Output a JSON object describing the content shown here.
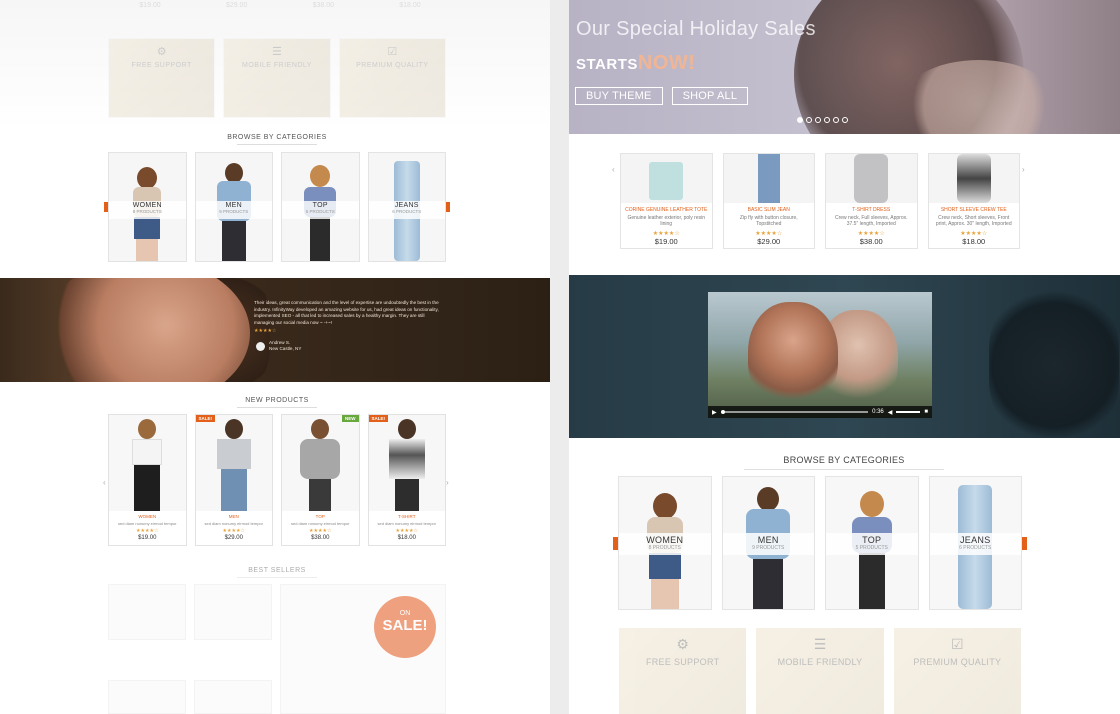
{
  "left": {
    "top_prices": [
      "$19.00",
      "$29.00",
      "$38.00",
      "$18.00"
    ],
    "features": [
      {
        "icon": "gears-icon",
        "title": "FREE SUPPORT"
      },
      {
        "icon": "mobile-icon",
        "title": "MOBILE FRIENDLY"
      },
      {
        "icon": "check-badge-icon",
        "title": "PREMIUM QUALITY"
      }
    ],
    "browse_title": "BROWSE BY CATEGORIES",
    "categories": [
      {
        "name": "WOMEN",
        "count": "8 PRODUCTS"
      },
      {
        "name": "MEN",
        "count": "9 PRODUCTS"
      },
      {
        "name": "TOP",
        "count": "5 PRODUCTS"
      },
      {
        "name": "JEANS",
        "count": "6 PRODUCTS"
      }
    ],
    "testimonial": {
      "quote": "Their ideas, great communication and the level of expertise are undoubtedly the best in the industry. InfinityWay developed an amazing website for us, had great ideas on functionality, implemented SEO - all that led to increased sales by a healthy margin. They are still managing our social media now ~ -+~!",
      "stars": "★★★★☆",
      "author": "Andrew S.",
      "location": "New Castle, NY"
    },
    "new_products_title": "NEW PRODUCTS",
    "new_products": [
      {
        "name": "WOMEN",
        "desc": "sed diam nonumy eirmod tempor",
        "stars": "★★★★☆",
        "price": "$19.00",
        "badge": ""
      },
      {
        "name": "MEN",
        "desc": "sed diam nonumy eirmod tempor",
        "stars": "★★★★☆",
        "price": "$29.00",
        "badge": "SALE!"
      },
      {
        "name": "TOP",
        "desc": "sed diam nonumy eirmod tempor",
        "stars": "★★★★☆",
        "price": "$38.00",
        "badge": "NEW"
      },
      {
        "name": "T-SHIRT",
        "desc": "sed diam nonumy eirmod tempor",
        "stars": "★★★★☆",
        "price": "$18.00",
        "badge": "SALE!"
      }
    ],
    "best_sellers_title": "BEST SELLERS",
    "on_sale": {
      "top": "ON",
      "bottom": "SALE!"
    }
  },
  "right": {
    "hero": {
      "headline": "Our Special Holiday Sales",
      "starts": "STARTS",
      "now": "NOW!",
      "buy_theme": "BUY THEME",
      "shop_all": "SHOP ALL",
      "slide_count": 6
    },
    "products": [
      {
        "name": "CORINE GENUINE LEATHER TOTE",
        "desc": "Genuine leather exterior, poly resin lining",
        "stars": "★★★★☆",
        "price": "$19.00"
      },
      {
        "name": "BASIC SLIM JEAN",
        "desc": "Zip fly with button closure, Topstitched",
        "stars": "★★★★☆",
        "price": "$29.00"
      },
      {
        "name": "T-SHIRT DRESS",
        "desc": "Crew neck, Full sleeves, Approx. 37.5\" length, Imported",
        "stars": "★★★★☆",
        "price": "$38.00"
      },
      {
        "name": "SHORT SLEEVE CREW TEE",
        "desc": "Crew neck, Short sleeves, Front print, Approx. 30\" length, Imported",
        "stars": "★★★★☆",
        "price": "$18.00"
      }
    ],
    "video_time": "0:36",
    "browse_title": "BROWSE BY CATEGORIES",
    "categories": [
      {
        "name": "WOMEN",
        "count": "8 PRODUCTS"
      },
      {
        "name": "MEN",
        "count": "9 PRODUCTS"
      },
      {
        "name": "TOP",
        "count": "5 PRODUCTS"
      },
      {
        "name": "JEANS",
        "count": "6 PRODUCTS"
      }
    ],
    "features": [
      {
        "icon": "gears-icon",
        "title": "FREE SUPPORT"
      },
      {
        "icon": "mobile-icon",
        "title": "MOBILE FRIENDLY"
      },
      {
        "icon": "check-badge-icon",
        "title": "PREMIUM QUALITY"
      }
    ]
  },
  "colors": {
    "accent": "#e2601a",
    "new_badge": "#69a83c",
    "star": "#e8a33a"
  }
}
